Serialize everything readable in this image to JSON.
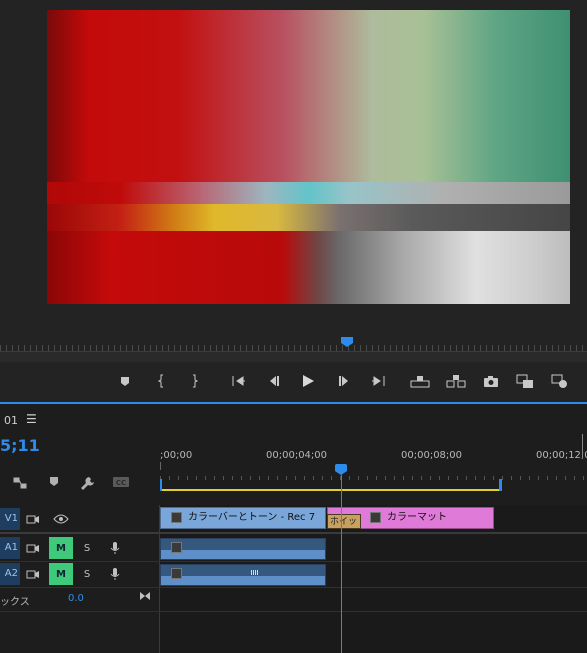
{
  "program_monitor": {
    "video_frame": "color bars and tone"
  },
  "transport": {
    "buttons": [
      "add-marker",
      "mark-in",
      "mark-out",
      "go-to-in",
      "step-back",
      "play",
      "step-forward",
      "go-to-out",
      "lift",
      "extract",
      "export-frame",
      "button-editor",
      "insert"
    ]
  },
  "timeline": {
    "sequence_tab": "01",
    "menu_glyph": "☰",
    "timecode": "5;11",
    "ruler_labels": [
      ";00;00",
      "00;00;04;00",
      "00;00;08;00",
      "00;00;12;0"
    ],
    "tracks": {
      "v1": {
        "label": "V1"
      },
      "a1": {
        "label": "A1",
        "mute": "M",
        "solo": "S"
      },
      "a2": {
        "label": "A2",
        "mute": "M",
        "solo": "S"
      }
    },
    "mix": {
      "label": "ックス",
      "value": "0.0"
    },
    "clips": {
      "bars": "カラーバーとトーン - Rec 7",
      "transition": "ホイッ",
      "matte": "カラーマット"
    }
  },
  "colors": {
    "accent": "#2d8ceb",
    "clip_video": "#7aa6d9",
    "clip_matte": "#e07ad8",
    "clip_audio": "#5f8fc8",
    "mute_on": "#3fc97a",
    "work_area": "#e0d030"
  }
}
